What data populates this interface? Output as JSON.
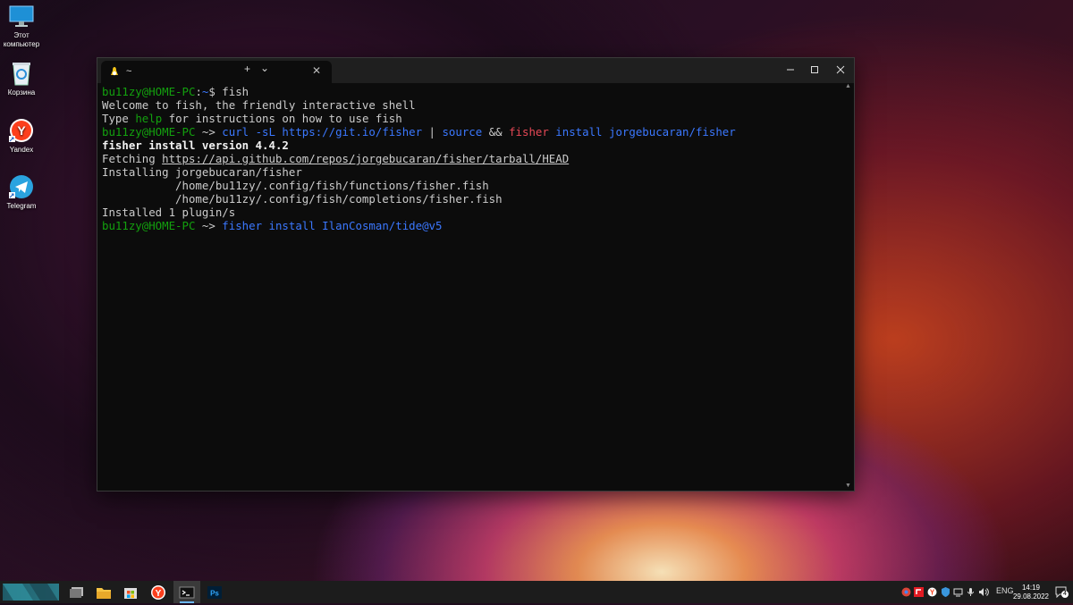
{
  "desktop": {
    "icons": [
      {
        "label": "Этот компьютер",
        "icon": "this-pc-icon"
      },
      {
        "label": "Корзина",
        "icon": "recycle-bin-icon"
      },
      {
        "label": "Yandex",
        "icon": "yandex-browser-icon"
      },
      {
        "label": "Telegram",
        "icon": "telegram-icon"
      }
    ]
  },
  "terminal": {
    "tab_title": "~",
    "tab_icon": "linux-penguin-icon",
    "new_tab_label": "+",
    "dropdown_label": "⌄",
    "lines": [
      [
        {
          "t": "bu11zy@HOME-PC",
          "c": "#13a10e"
        },
        {
          "t": ":",
          "c": "#cccccc"
        },
        {
          "t": "~",
          "c": "#3b78ff"
        },
        {
          "t": "$ fish",
          "c": "#cccccc"
        }
      ],
      [
        {
          "t": "Welcome to fish, the friendly interactive shell",
          "c": "#cccccc"
        }
      ],
      [
        {
          "t": "Type ",
          "c": "#cccccc"
        },
        {
          "t": "help",
          "c": "#13a10e"
        },
        {
          "t": " for instructions on how to use fish",
          "c": "#cccccc"
        }
      ],
      [
        {
          "t": "bu11zy@HOME-PC",
          "c": "#13a10e"
        },
        {
          "t": " ~> ",
          "c": "#cccccc"
        },
        {
          "t": "curl -sL https://git.io/fisher",
          "c": "#3b78ff"
        },
        {
          "t": " | ",
          "c": "#cccccc"
        },
        {
          "t": "source",
          "c": "#3b78ff"
        },
        {
          "t": " && ",
          "c": "#cccccc"
        },
        {
          "t": "fisher",
          "c": "#e74856"
        },
        {
          "t": " install jorgebucaran/fisher",
          "c": "#3b78ff"
        }
      ],
      [
        {
          "t": "fisher install version 4.4.2",
          "c": "#f2f2f2",
          "b": true
        }
      ],
      [
        {
          "t": "Fetching ",
          "c": "#cccccc"
        },
        {
          "t": "https://api.github.com/repos/jorgebucaran/fisher/tarball/HEAD",
          "c": "#cccccc",
          "u": true
        }
      ],
      [
        {
          "t": "Installing jorgebucaran/fisher",
          "c": "#cccccc"
        }
      ],
      [
        {
          "t": "           /home/bu11zy/.config/fish/functions/fisher.fish",
          "c": "#cccccc"
        }
      ],
      [
        {
          "t": "           /home/bu11zy/.config/fish/completions/fisher.fish",
          "c": "#cccccc"
        }
      ],
      [
        {
          "t": "Installed 1 plugin/s",
          "c": "#cccccc"
        }
      ],
      [
        {
          "t": "bu11zy@HOME-PC",
          "c": "#13a10e"
        },
        {
          "t": " ~> ",
          "c": "#cccccc"
        },
        {
          "t": "fisher",
          "c": "#3b78ff"
        },
        {
          "t": " install IlanCosman/tide@v5",
          "c": "#3b78ff"
        }
      ]
    ]
  },
  "taskbar": {
    "apps": [
      "task-view-icon",
      "file-explorer-icon",
      "microsoft-store-icon",
      "yandex-browser-icon",
      "windows-terminal-icon",
      "photoshop-icon"
    ],
    "photoshop_label": "Ps",
    "lang": "ENG",
    "time": "14:19",
    "date": "29.08.2022",
    "notification_count": "4"
  }
}
